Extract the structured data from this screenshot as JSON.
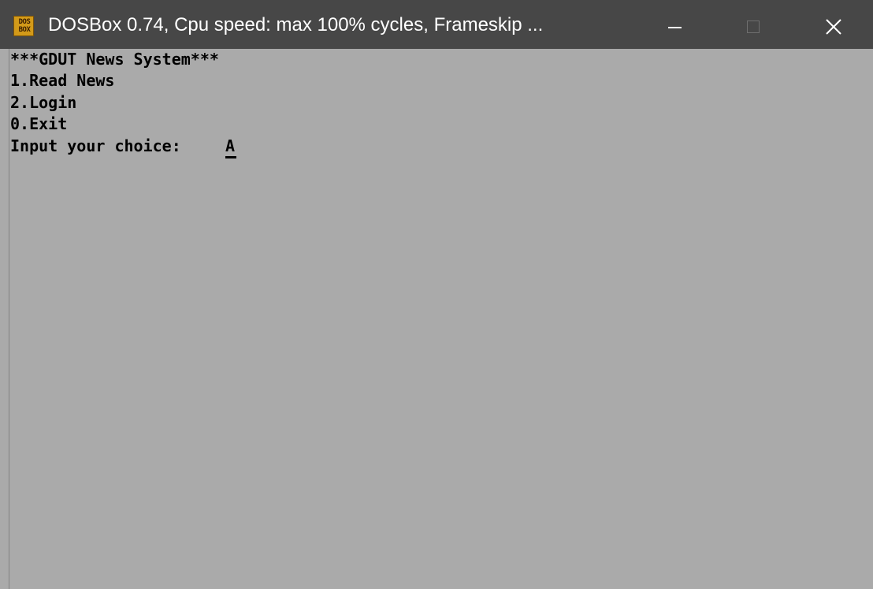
{
  "window": {
    "title": "DOSBox 0.74, Cpu speed: max 100% cycles, Frameskip ...",
    "icon_name": "dosbox-icon",
    "icon_lines": [
      "DOS",
      "BOX"
    ],
    "controls": {
      "minimize_icon": "minimize-icon",
      "maximize_icon": "maximize-icon",
      "close_icon": "close-icon"
    },
    "titlebar_color": "#474747",
    "screen_background": "#aaaaaa",
    "text_color": "#000000"
  },
  "console": {
    "title_line": "***GDUT News System***",
    "options": [
      "1.Read News",
      "2.Login",
      "0.Exit"
    ],
    "prompt": "Input your choice:",
    "typed_value": "A"
  }
}
